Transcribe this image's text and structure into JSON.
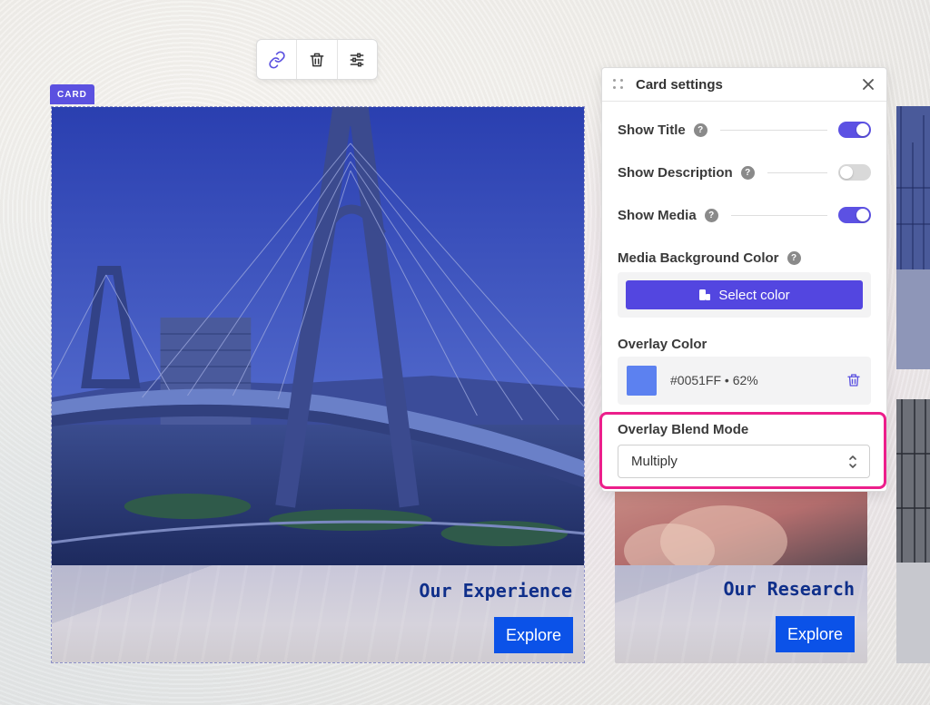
{
  "toolbar": {
    "icons": [
      "link-icon",
      "trash-icon",
      "sliders-icon"
    ]
  },
  "card_badge": "CARD",
  "cards": [
    {
      "title": "Our Experience",
      "button": "Explore"
    },
    {
      "title": "Our Research",
      "button": "Explore"
    }
  ],
  "panel": {
    "title": "Card settings",
    "settings": [
      {
        "label": "Show Title",
        "enabled": true
      },
      {
        "label": "Show Description",
        "enabled": false
      },
      {
        "label": "Show Media",
        "enabled": true
      }
    ],
    "media_bg": {
      "label": "Media Background Color",
      "button": "Select color"
    },
    "overlay": {
      "label": "Overlay Color",
      "value": "#0051FF • 62%",
      "swatch_color": "#0051FF"
    },
    "blend": {
      "label": "Overlay Blend Mode",
      "selected": "Multiply"
    }
  },
  "colors": {
    "accent": "#5C51E3",
    "highlight": "#EC1F8B",
    "explore_button": "#0B52E8"
  }
}
